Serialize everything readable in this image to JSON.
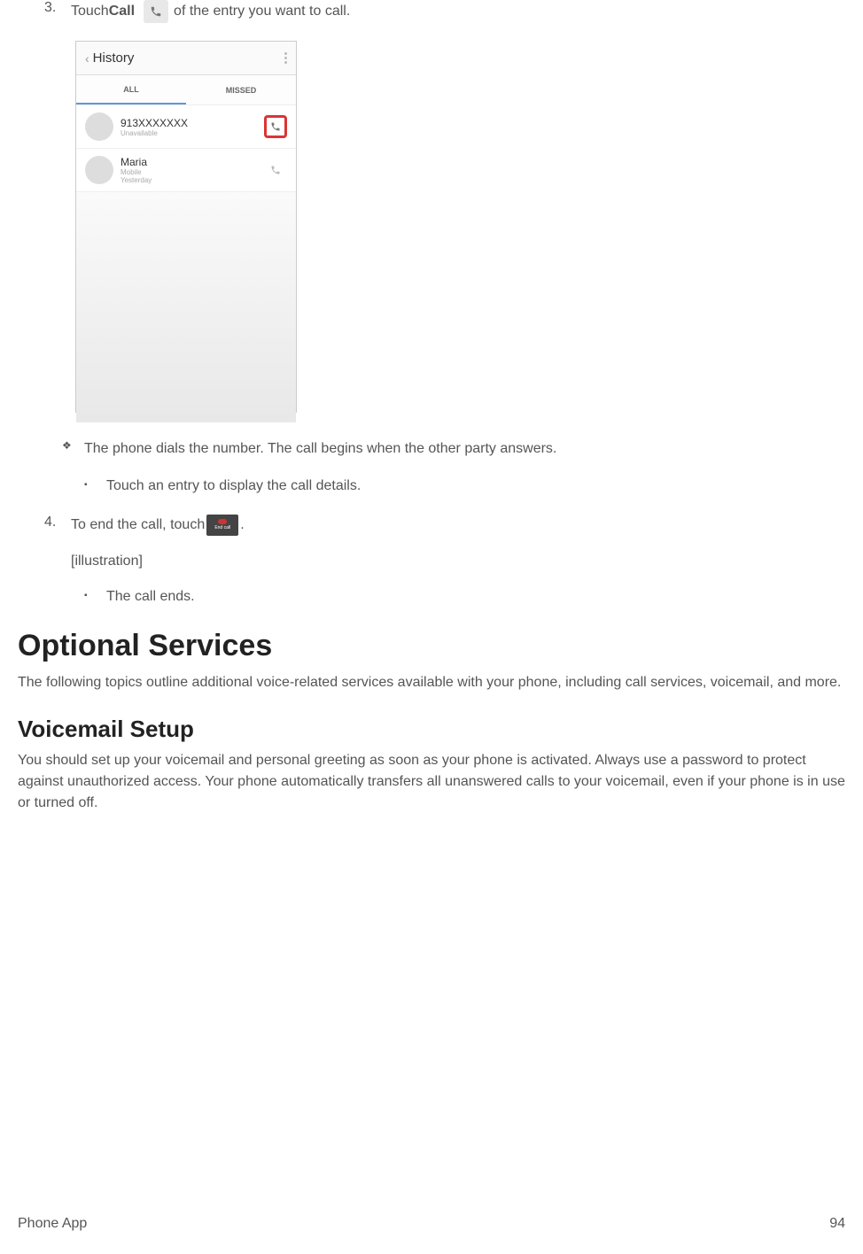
{
  "step3": {
    "number": "3.",
    "text_before": "Touch ",
    "bold": "Call",
    "text_after": " of the entry you want to call."
  },
  "screenshot": {
    "back": "‹",
    "title": "History",
    "tabs": {
      "all": "ALL",
      "missed": "MISSED"
    },
    "entry1": {
      "name": "913XXXXXXX",
      "sub": "Unavailable"
    },
    "entry2": {
      "name": "Maria",
      "sub1": "Mobile",
      "sub2": "Yesterday"
    }
  },
  "bullet_dial": "The phone dials the number. The call begins when the other party answers.",
  "bullet_touch_entry": "Touch an entry to display the call details.",
  "step4": {
    "number": "4.",
    "text_before": "To end the call, touch ",
    "text_after": "."
  },
  "end_call_label": "End call",
  "illustration": "[illustration]",
  "bullet_call_ends": "The call ends.",
  "heading1": "Optional Services",
  "para1": "The following topics outline additional voice-related services available with your phone, including call services, voicemail, and more.",
  "heading2": "Voicemail Setup",
  "para2": "You should set up your voicemail and personal greeting as soon as your phone is activated. Always use a password to protect against unauthorized access. Your phone automatically transfers all unanswered calls to your voicemail, even if your phone is in use or turned off.",
  "footer": {
    "left": "Phone App",
    "right": "94"
  }
}
